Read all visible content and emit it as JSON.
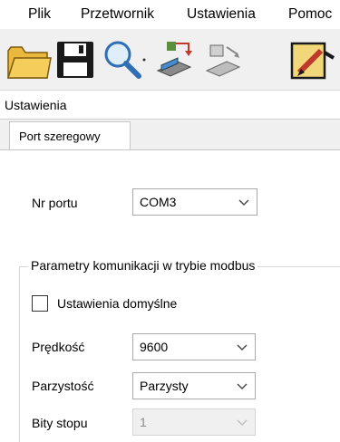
{
  "menubar": {
    "items": [
      "Plik",
      "Przetwornik",
      "Ustawienia",
      "Pomoc"
    ]
  },
  "toolbar": {
    "buttons": [
      "open-folder-icon",
      "save-icon",
      "search-icon",
      "device-transfer-icon",
      "device-read-icon",
      "edit-settings-icon"
    ]
  },
  "panel": {
    "title": "Ustawienia"
  },
  "tabs": {
    "active": "Port szeregowy"
  },
  "port": {
    "label": "Nr portu",
    "value": "COM3"
  },
  "modbus": {
    "legend": "Parametry komunikacji w trybie modbus",
    "defaults_label": "Ustawienia domyślne",
    "defaults_checked": false,
    "speed_label": "Prędkość",
    "speed_value": "9600",
    "parity_label": "Parzystość",
    "parity_value": "Parzysty",
    "stopbits_label": "Bity stopu",
    "stopbits_value": "1"
  },
  "colors": {
    "folder": "#f5cd5a",
    "save": "#1a1a1a",
    "accent_red": "#c0392b"
  }
}
